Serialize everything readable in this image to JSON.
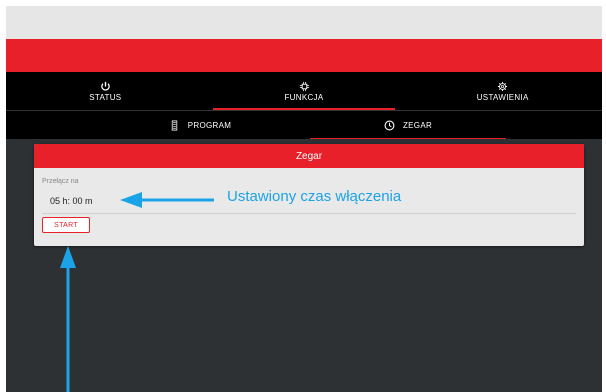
{
  "nav": {
    "items": [
      {
        "label": "STATUS",
        "icon": "power-icon"
      },
      {
        "label": "FUNKCJA",
        "icon": "chip-icon"
      },
      {
        "label": "USTAWIENIA",
        "icon": "gear-icon"
      }
    ],
    "active": "FUNKCJA"
  },
  "subnav": {
    "items": [
      {
        "label": "PROGRAM",
        "icon": "program-icon"
      },
      {
        "label": "ZEGAR",
        "icon": "clock-icon"
      }
    ],
    "active": "ZEGAR"
  },
  "card": {
    "title": "Zegar",
    "field_label": "Przełącz na",
    "field_value": "05 h: 00 m",
    "start_label": "START"
  },
  "annotation": {
    "text": "Ustawiony czas włączenia"
  },
  "colors": {
    "accent": "#e8202a",
    "annotation": "#1ba3e8",
    "background": "#2e3134"
  }
}
